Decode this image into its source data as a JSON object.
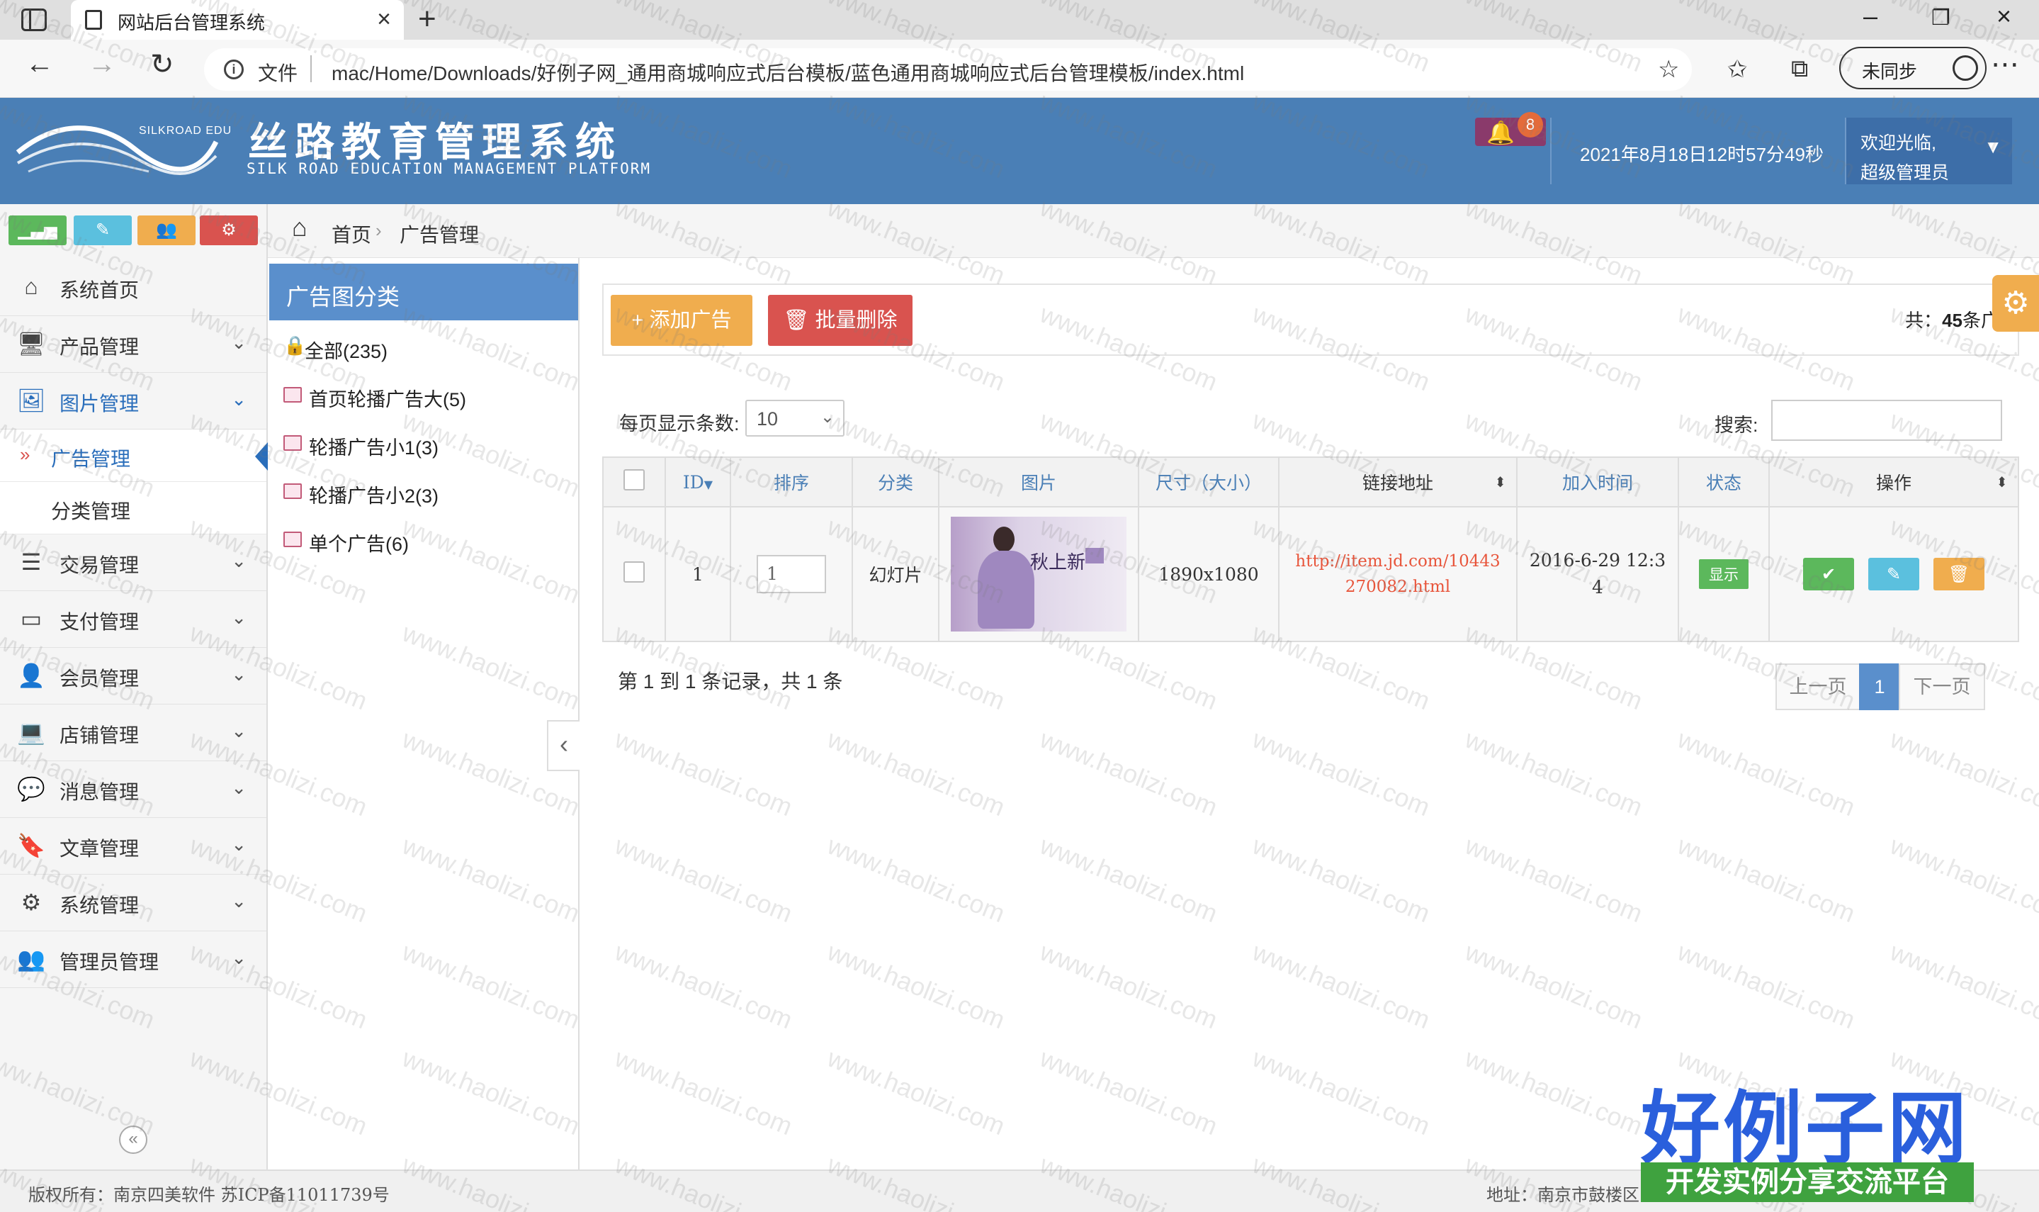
{
  "browser": {
    "tab_title": "网站后台管理系统",
    "url_scheme": "文件",
    "url": "mac/Home/Downloads/好例子网_通用商城响应式后台模板/蓝色通用商城响应式后台管理模板/index.html",
    "sync_label": "未同步"
  },
  "header": {
    "logo_en": "SILKROAD EDU",
    "logo_cn": "丝路教育管理系统",
    "logo_sub": "SILK ROAD EDUCATION MANAGEMENT PLATFORM",
    "notification_count": "8",
    "datetime": "2021年8月18日12时57分49秒",
    "welcome": "欢迎光临,",
    "user_name": "超级管理员"
  },
  "shortcuts": [
    {
      "icon": "bar-chart-icon",
      "color": "#5cb85c"
    },
    {
      "icon": "pencil-icon",
      "color": "#5bc0de"
    },
    {
      "icon": "users-icon",
      "color": "#f0ad4e"
    },
    {
      "icon": "gears-icon",
      "color": "#d9534f"
    }
  ],
  "sidebar": {
    "items": [
      {
        "label": "系统首页",
        "icon": "home-icon"
      },
      {
        "label": "产品管理",
        "icon": "desktop-icon"
      },
      {
        "label": "图片管理",
        "icon": "picture-icon"
      },
      {
        "label": "交易管理",
        "icon": "list-icon"
      },
      {
        "label": "支付管理",
        "icon": "credit-card-icon"
      },
      {
        "label": "会员管理",
        "icon": "user-icon"
      },
      {
        "label": "店铺管理",
        "icon": "laptop-icon"
      },
      {
        "label": "消息管理",
        "icon": "comments-icon"
      },
      {
        "label": "文章管理",
        "icon": "bookmark-icon"
      },
      {
        "label": "系统管理",
        "icon": "cogs-icon"
      },
      {
        "label": "管理员管理",
        "icon": "group-icon"
      }
    ],
    "sub_items": [
      {
        "label": "广告管理"
      },
      {
        "label": "分类管理"
      }
    ]
  },
  "breadcrumb": {
    "home": "首页",
    "current": "广告管理"
  },
  "category_panel": {
    "title": "广告图分类",
    "items": [
      {
        "label": "全部(235)"
      },
      {
        "label": "首页轮播广告大(5)"
      },
      {
        "label": "轮播广告小1(3)"
      },
      {
        "label": "轮播广告小2(3)"
      },
      {
        "label": "单个广告(6)"
      }
    ]
  },
  "toolbar": {
    "add_label": "添加广告",
    "batch_delete_label": "批量删除",
    "total_prefix": "共：",
    "total_count": "45",
    "total_suffix": "条广告"
  },
  "table_controls": {
    "page_size_label": "每页显示条数:",
    "page_size_value": "10",
    "search_label": "搜索:"
  },
  "table": {
    "columns": [
      "ID",
      "排序",
      "分类",
      "图片",
      "尺寸（大小）",
      "链接地址",
      "加入时间",
      "状态",
      "操作"
    ],
    "rows": [
      {
        "id": "1",
        "order": "1",
        "category": "幻灯片",
        "image_text": "秋上新",
        "size": "1890x1080",
        "link": "http://item.jd.com/10443270082.html",
        "added": "2016-6-29 12:34",
        "status": "显示"
      }
    ]
  },
  "pagination": {
    "info": "第 1 到 1 条记录，共 1 条",
    "prev": "上一页",
    "current": "1",
    "next": "下一页"
  },
  "footer": {
    "left": "版权所有：南京四美软件  苏ICP备11011739号",
    "right": "地址：南京市鼓楼区"
  },
  "watermark": {
    "site": "www.haolizi.com",
    "brand": "好例子网",
    "strip": "开发实例分享交流平台"
  },
  "colors": {
    "header_bg": "#4a7fb6",
    "accent": "#2a6ebb",
    "warning": "#f0ad4e",
    "danger": "#d9534f",
    "success": "#5cb85c",
    "info": "#5bc0de"
  }
}
